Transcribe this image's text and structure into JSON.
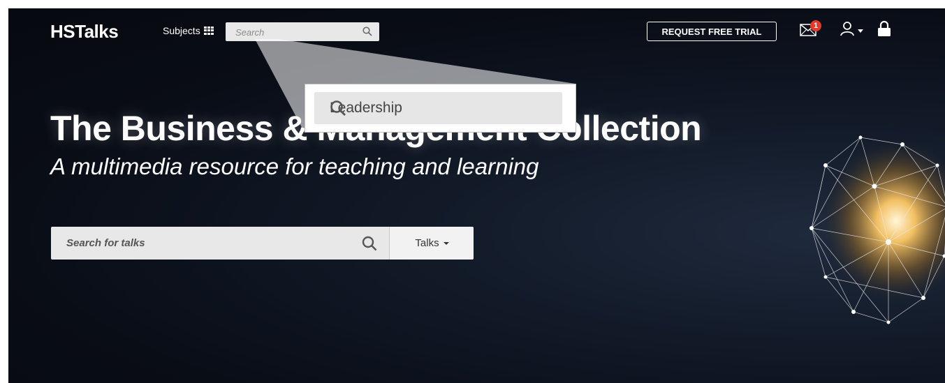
{
  "header": {
    "logo": "HSTalks",
    "subjects_label": "Subjects",
    "search_placeholder": "Search",
    "trial_button": "REQUEST FREE TRIAL",
    "notification_count": "1",
    "icons": [
      "grid-icon",
      "search-icon",
      "mail-icon",
      "user-icon",
      "chevron-down-icon",
      "lock-icon"
    ]
  },
  "hero": {
    "title": "The Business & Management Collection",
    "subtitle": "A multimedia resource for teaching and learning",
    "search_placeholder": "Search for talks",
    "dropdown_label": "Talks"
  },
  "callout": {
    "value": "Leadership"
  },
  "colors": {
    "badge": "#e53a2a",
    "background": "#0a0e17",
    "search_field": "#e8e8e8"
  }
}
